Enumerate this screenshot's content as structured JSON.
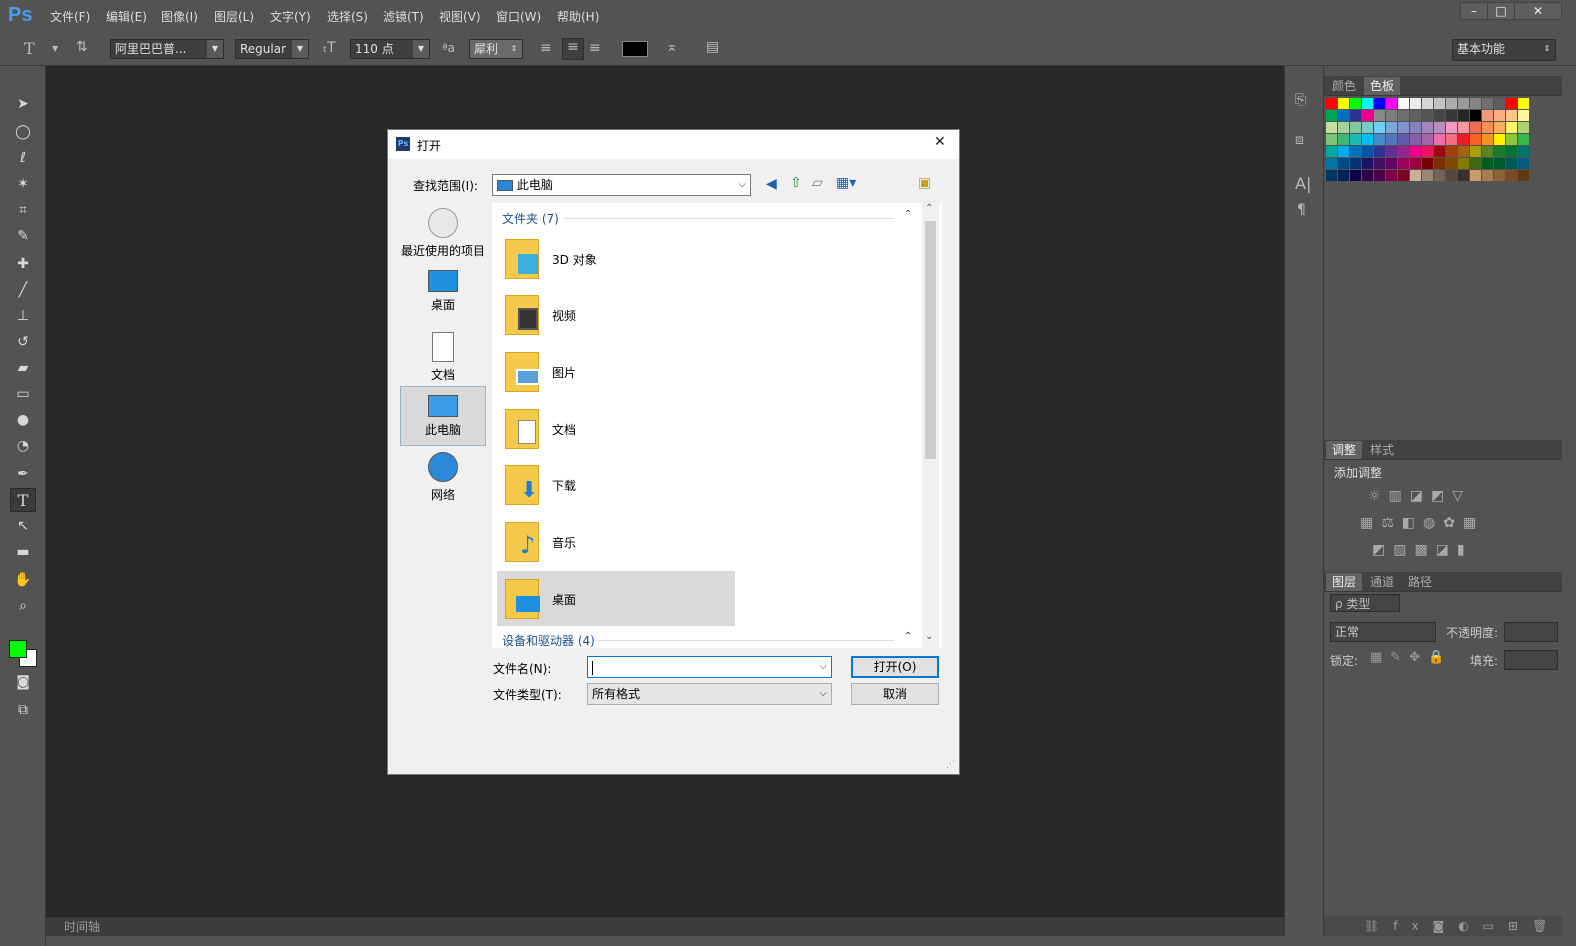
{
  "app": {
    "logo": "Ps"
  },
  "menu": [
    "文件(F)",
    "编辑(E)",
    "图像(I)",
    "图层(L)",
    "文字(Y)",
    "选择(S)",
    "滤镜(T)",
    "视图(V)",
    "窗口(W)",
    "帮助(H)"
  ],
  "window_controls": {
    "minimize": "–",
    "maximize": "□",
    "close": "✕"
  },
  "options": {
    "font_family": "阿里巴巴普...",
    "font_style": "Regular",
    "font_size": "110 点",
    "antialias": "犀利",
    "aa_label": "ªa",
    "workspace": "基本功能",
    "text_color": "#000000"
  },
  "toolbar": {
    "icons": [
      "move-icon",
      "marquee-icon",
      "lasso-icon",
      "magic-wand-icon",
      "crop-icon",
      "eyedropper-icon",
      "healing-brush-icon",
      "brush-icon",
      "clone-stamp-icon",
      "history-brush-icon",
      "eraser-icon",
      "gradient-icon",
      "blur-icon",
      "dodge-icon",
      "pen-icon",
      "type-icon",
      "path-selection-icon",
      "rectangle-icon",
      "hand-icon",
      "zoom-icon"
    ],
    "foreground_color": "#00ff00",
    "background_color": "#ffffff"
  },
  "timeline": {
    "label": "时间轴"
  },
  "panels": {
    "color_tabs": [
      "颜色",
      "色板"
    ],
    "adjust_tabs": [
      "调整",
      "样式"
    ],
    "add_adjustment": "添加调整",
    "layer_tabs": [
      "图层",
      "通道",
      "路径"
    ],
    "layer_filter": "ρ 类型",
    "blend_mode": "正常",
    "opacity_label": "不透明度:",
    "lock_label": "锁定:",
    "fill_label": "填充:"
  },
  "dialog": {
    "title": "打开",
    "close": "✕",
    "look_in_label": "查找范围(I):",
    "look_in_value": "此电脑",
    "places": [
      {
        "label": "最近使用的项目",
        "selected": false
      },
      {
        "label": "桌面",
        "selected": false
      },
      {
        "label": "文档",
        "selected": false
      },
      {
        "label": "此电脑",
        "selected": true
      },
      {
        "label": "网络",
        "selected": false
      }
    ],
    "group_folders": "文件夹 (7)",
    "folders": [
      "3D 对象",
      "视频",
      "图片",
      "文档",
      "下载",
      "音乐",
      "桌面"
    ],
    "group_devices": "设备和驱动器 (4)",
    "filename_label": "文件名(N):",
    "filename_value": "",
    "filetype_label": "文件类型(T):",
    "filetype_value": "所有格式",
    "open_button": "打开(O)",
    "cancel_button": "取消"
  }
}
